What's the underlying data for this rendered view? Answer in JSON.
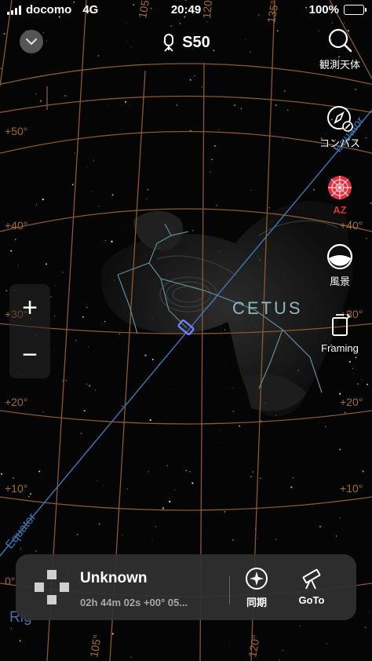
{
  "status_bar": {
    "carrier": "docomo",
    "network": "4G",
    "time": "20:49",
    "battery": "100%"
  },
  "header": {
    "device_name": "S50"
  },
  "tools": {
    "search": "観測天体",
    "compass": "コンパス",
    "az": "AZ",
    "landscape": "風景",
    "framing": "Framing"
  },
  "sky": {
    "constellation": "CETUS",
    "equator_label": "Equator",
    "equator_label_right": "Equator",
    "dec_labels_left": [
      "+50°",
      "+40°",
      "+30°",
      "+20°",
      "+10°",
      "0°"
    ],
    "dec_labels_right": [
      "+40°",
      "+30°",
      "+20°",
      "+10°"
    ],
    "ra_labels_top": [
      "105°",
      "120°",
      "135°"
    ],
    "ra_labels_bottom": [
      "105°",
      "120°"
    ],
    "corner_fragment": "Rig",
    "colors": {
      "grid": "#8a5a2e",
      "grid_label": "#a06a38",
      "equator": "#3f78b8",
      "constellation_line": "#5f8d96",
      "marker": "#6f7fff",
      "az_accent": "#e0303e"
    }
  },
  "zoom": {
    "plus": "+",
    "minus": "−"
  },
  "bottom_panel": {
    "object_name": "Unknown",
    "coordinates": "02h 44m 02s  +00° 05...",
    "sync_label": "同期",
    "goto_label": "GoTo"
  }
}
